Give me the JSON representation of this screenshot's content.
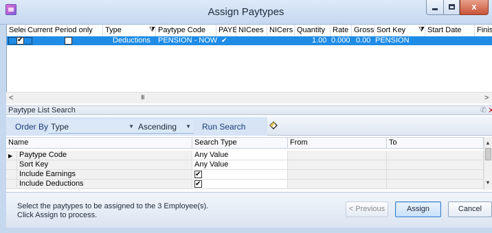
{
  "window": {
    "title": "Assign Paytypes",
    "minimize_label": "",
    "maximize_label": "",
    "close_label": "x"
  },
  "paytype_grid": {
    "columns": [
      "Select",
      "Current Period only",
      "Type",
      "Paytype Code",
      "PAYE",
      "NICees",
      "NICers",
      "Quantity",
      "Rate",
      "Gross",
      "Sort Key",
      "Start Date",
      "Finish Dat"
    ],
    "filtered_columns": [
      "Type",
      "Sort Key"
    ],
    "rows": [
      {
        "select": true,
        "current_period_only": false,
        "type": "Deductions",
        "paytype_code": "PENSION - NOW",
        "paye": true,
        "nicees": "",
        "nicers": "",
        "quantity": "1.00",
        "rate": "0.000",
        "gross": "0.00",
        "sort_key": "PENSION",
        "start_date": "",
        "finish_date": ""
      }
    ],
    "selected_color": "#1f8ce6"
  },
  "scrollbar": {
    "left_arrow": "<",
    "grip": "III",
    "right_arrow": ">"
  },
  "search_panel": {
    "title": "Paytype List Search",
    "order_by_label": "Order By",
    "order_by_value": "Type",
    "direction_value": "Ascending",
    "run_search_label": "Run Search",
    "columns": [
      "Name",
      "Search Type",
      "From",
      "To"
    ],
    "rows": [
      {
        "name": "Paytype Code",
        "search_type": "Any Value",
        "is_checkbox": false,
        "current": true
      },
      {
        "name": "Sort Key",
        "search_type": "Any Value",
        "is_checkbox": false,
        "current": false
      },
      {
        "name": "Include Earnings",
        "search_type": "",
        "is_checkbox": true,
        "checked": true,
        "current": false
      },
      {
        "name": "Include Deductions",
        "search_type": "",
        "is_checkbox": true,
        "checked": true,
        "current": false
      }
    ]
  },
  "footer": {
    "message_line1": "Select the paytypes to be assigned to the 3 Employee(s).",
    "message_line2": "Click Assign to process.",
    "previous_label": "< Previous",
    "assign_label": "Assign",
    "cancel_label": "Cancel"
  }
}
